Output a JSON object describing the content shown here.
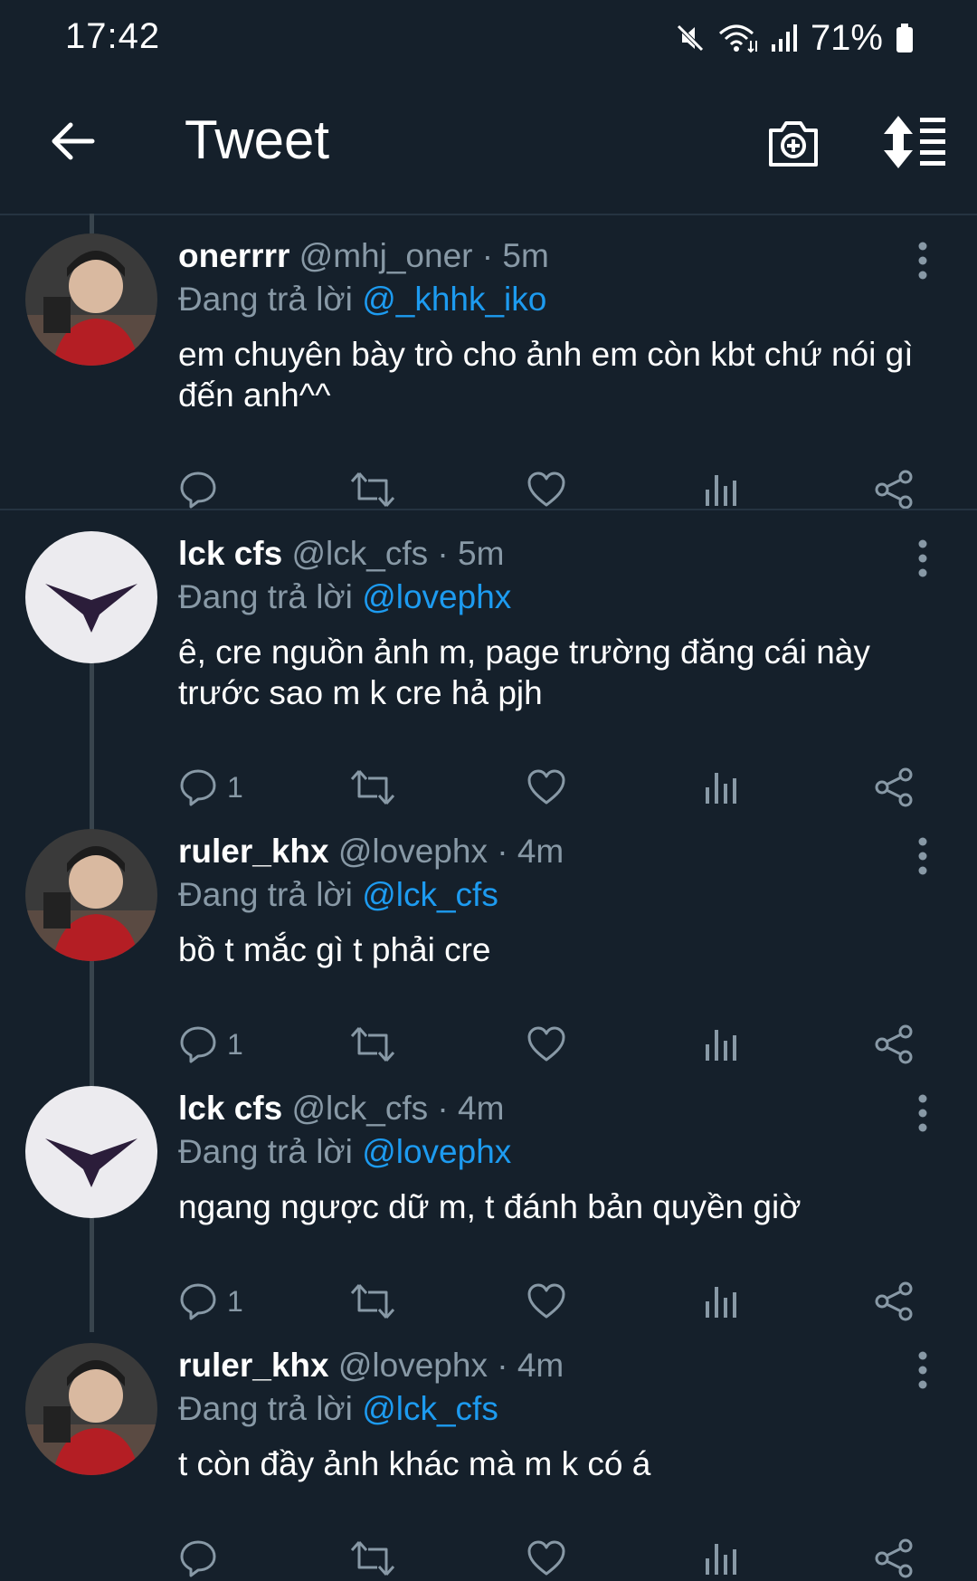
{
  "status": {
    "time": "17:42",
    "battery": "71%"
  },
  "header": {
    "title": "Tweet"
  },
  "reply_prefix": "Đang trả lời",
  "separator": "·",
  "tweets": [
    {
      "name": "onerrrr",
      "handle": "@mhj_oner",
      "time": "5m",
      "reply_to": "@_khhk_iko",
      "text": "em chuyên bày trò cho ảnh em còn kbt chứ nói gì đến anh^^",
      "replies": "",
      "avatar": "photo-avatar"
    },
    {
      "name": "lck cfs",
      "handle": "@lck_cfs",
      "time": "5m",
      "reply_to": "@lovephx",
      "text": "ê, cre nguồn ảnh m, page trường đăng cái này trước sao m k cre hả pjh",
      "replies": "1",
      "avatar": "logo-avatar"
    },
    {
      "name": "ruler_khx",
      "handle": "@lovephx",
      "time": "4m",
      "reply_to": "@lck_cfs",
      "text": "bồ t mắc gì t phải cre",
      "replies": "1",
      "avatar": "photo-avatar"
    },
    {
      "name": "lck cfs",
      "handle": "@lck_cfs",
      "time": "4m",
      "reply_to": "@lovephx",
      "text": "ngang ngược dữ m, t đánh bản quyền giờ",
      "replies": "1",
      "avatar": "logo-avatar"
    },
    {
      "name": "ruler_khx",
      "handle": "@lovephx",
      "time": "4m",
      "reply_to": "@lck_cfs",
      "text": "t còn đầy ảnh khác mà m k có á",
      "replies": "",
      "avatar": "photo-avatar"
    }
  ],
  "icons": {
    "back": "arrow-left-icon",
    "camera": "camera-plus-icon",
    "sort": "sort-icon",
    "reply": "reply-icon",
    "retweet": "retweet-icon",
    "like": "heart-icon",
    "views": "views-icon",
    "share": "share-icon",
    "more": "more-vertical-icon"
  },
  "colors": {
    "background": "#15202b",
    "text": "#ffffff",
    "muted": "#8899a6",
    "accent": "#1d9bf0",
    "line": "#38444d"
  }
}
